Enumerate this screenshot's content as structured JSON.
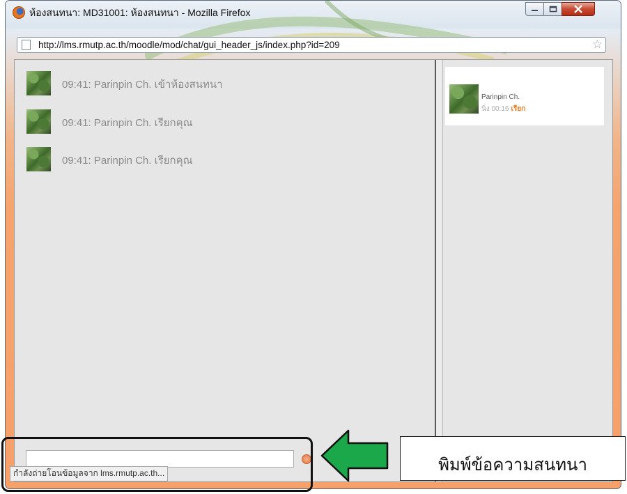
{
  "window": {
    "title": "ห้องสนทนา: MD31001: ห้องสนทนา - Mozilla Firefox",
    "url": "http://lms.rmutp.ac.th/moodle/mod/chat/gui_header_js/index.php?id=209"
  },
  "messages": [
    {
      "text": "09:41: Parinpin Ch. เข้าห้องสนทนา"
    },
    {
      "text": "09:41: Parinpin Ch. เรียกคุณ"
    },
    {
      "text": "09:41: Parinpin Ch. เรียกคุณ"
    }
  ],
  "users": [
    {
      "name": "Parinpin Ch.",
      "idle": "นิ่ง 00:16",
      "beep": "เรียก"
    }
  ],
  "input": {
    "value": "",
    "placeholder": ""
  },
  "status_tip": "กำลังถ่ายโอนข้อมูลจาก lms.rmutp.ac.th...",
  "annotation": {
    "callout": "พิมพ์ข้อความสนทนา",
    "arrow_color": "#1aa84a"
  }
}
